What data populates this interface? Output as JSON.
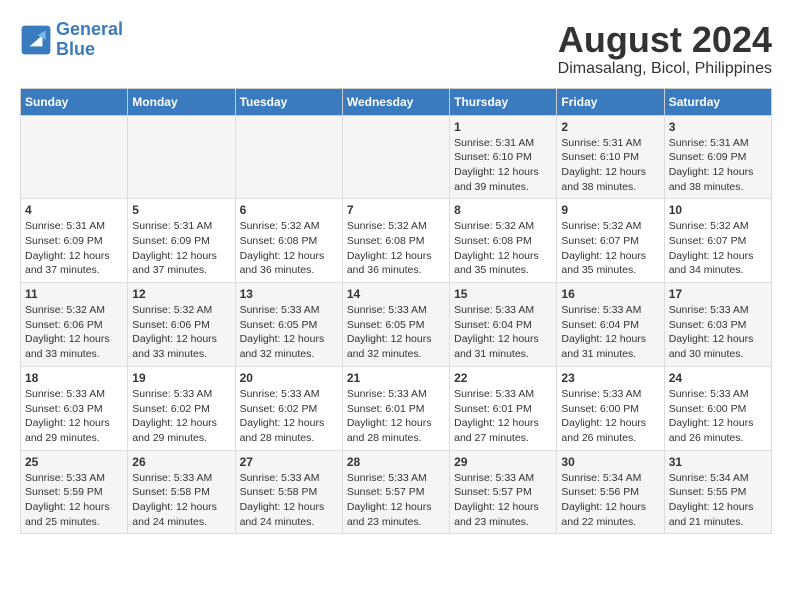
{
  "logo": {
    "line1": "General",
    "line2": "Blue"
  },
  "title": "August 2024",
  "subtitle": "Dimasalang, Bicol, Philippines",
  "days_of_week": [
    "Sunday",
    "Monday",
    "Tuesday",
    "Wednesday",
    "Thursday",
    "Friday",
    "Saturday"
  ],
  "weeks": [
    [
      {
        "day": "",
        "info": ""
      },
      {
        "day": "",
        "info": ""
      },
      {
        "day": "",
        "info": ""
      },
      {
        "day": "",
        "info": ""
      },
      {
        "day": "1",
        "info": "Sunrise: 5:31 AM\nSunset: 6:10 PM\nDaylight: 12 hours\nand 39 minutes."
      },
      {
        "day": "2",
        "info": "Sunrise: 5:31 AM\nSunset: 6:10 PM\nDaylight: 12 hours\nand 38 minutes."
      },
      {
        "day": "3",
        "info": "Sunrise: 5:31 AM\nSunset: 6:09 PM\nDaylight: 12 hours\nand 38 minutes."
      }
    ],
    [
      {
        "day": "4",
        "info": "Sunrise: 5:31 AM\nSunset: 6:09 PM\nDaylight: 12 hours\nand 37 minutes."
      },
      {
        "day": "5",
        "info": "Sunrise: 5:31 AM\nSunset: 6:09 PM\nDaylight: 12 hours\nand 37 minutes."
      },
      {
        "day": "6",
        "info": "Sunrise: 5:32 AM\nSunset: 6:08 PM\nDaylight: 12 hours\nand 36 minutes."
      },
      {
        "day": "7",
        "info": "Sunrise: 5:32 AM\nSunset: 6:08 PM\nDaylight: 12 hours\nand 36 minutes."
      },
      {
        "day": "8",
        "info": "Sunrise: 5:32 AM\nSunset: 6:08 PM\nDaylight: 12 hours\nand 35 minutes."
      },
      {
        "day": "9",
        "info": "Sunrise: 5:32 AM\nSunset: 6:07 PM\nDaylight: 12 hours\nand 35 minutes."
      },
      {
        "day": "10",
        "info": "Sunrise: 5:32 AM\nSunset: 6:07 PM\nDaylight: 12 hours\nand 34 minutes."
      }
    ],
    [
      {
        "day": "11",
        "info": "Sunrise: 5:32 AM\nSunset: 6:06 PM\nDaylight: 12 hours\nand 33 minutes."
      },
      {
        "day": "12",
        "info": "Sunrise: 5:32 AM\nSunset: 6:06 PM\nDaylight: 12 hours\nand 33 minutes."
      },
      {
        "day": "13",
        "info": "Sunrise: 5:33 AM\nSunset: 6:05 PM\nDaylight: 12 hours\nand 32 minutes."
      },
      {
        "day": "14",
        "info": "Sunrise: 5:33 AM\nSunset: 6:05 PM\nDaylight: 12 hours\nand 32 minutes."
      },
      {
        "day": "15",
        "info": "Sunrise: 5:33 AM\nSunset: 6:04 PM\nDaylight: 12 hours\nand 31 minutes."
      },
      {
        "day": "16",
        "info": "Sunrise: 5:33 AM\nSunset: 6:04 PM\nDaylight: 12 hours\nand 31 minutes."
      },
      {
        "day": "17",
        "info": "Sunrise: 5:33 AM\nSunset: 6:03 PM\nDaylight: 12 hours\nand 30 minutes."
      }
    ],
    [
      {
        "day": "18",
        "info": "Sunrise: 5:33 AM\nSunset: 6:03 PM\nDaylight: 12 hours\nand 29 minutes."
      },
      {
        "day": "19",
        "info": "Sunrise: 5:33 AM\nSunset: 6:02 PM\nDaylight: 12 hours\nand 29 minutes."
      },
      {
        "day": "20",
        "info": "Sunrise: 5:33 AM\nSunset: 6:02 PM\nDaylight: 12 hours\nand 28 minutes."
      },
      {
        "day": "21",
        "info": "Sunrise: 5:33 AM\nSunset: 6:01 PM\nDaylight: 12 hours\nand 28 minutes."
      },
      {
        "day": "22",
        "info": "Sunrise: 5:33 AM\nSunset: 6:01 PM\nDaylight: 12 hours\nand 27 minutes."
      },
      {
        "day": "23",
        "info": "Sunrise: 5:33 AM\nSunset: 6:00 PM\nDaylight: 12 hours\nand 26 minutes."
      },
      {
        "day": "24",
        "info": "Sunrise: 5:33 AM\nSunset: 6:00 PM\nDaylight: 12 hours\nand 26 minutes."
      }
    ],
    [
      {
        "day": "25",
        "info": "Sunrise: 5:33 AM\nSunset: 5:59 PM\nDaylight: 12 hours\nand 25 minutes."
      },
      {
        "day": "26",
        "info": "Sunrise: 5:33 AM\nSunset: 5:58 PM\nDaylight: 12 hours\nand 24 minutes."
      },
      {
        "day": "27",
        "info": "Sunrise: 5:33 AM\nSunset: 5:58 PM\nDaylight: 12 hours\nand 24 minutes."
      },
      {
        "day": "28",
        "info": "Sunrise: 5:33 AM\nSunset: 5:57 PM\nDaylight: 12 hours\nand 23 minutes."
      },
      {
        "day": "29",
        "info": "Sunrise: 5:33 AM\nSunset: 5:57 PM\nDaylight: 12 hours\nand 23 minutes."
      },
      {
        "day": "30",
        "info": "Sunrise: 5:34 AM\nSunset: 5:56 PM\nDaylight: 12 hours\nand 22 minutes."
      },
      {
        "day": "31",
        "info": "Sunrise: 5:34 AM\nSunset: 5:55 PM\nDaylight: 12 hours\nand 21 minutes."
      }
    ]
  ]
}
